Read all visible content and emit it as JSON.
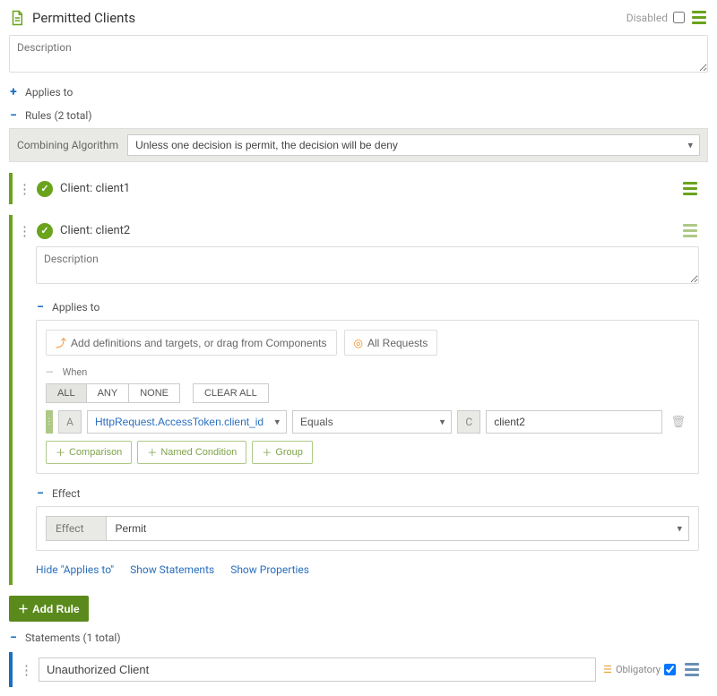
{
  "header": {
    "title": "Permitted Clients",
    "disabled_label": "Disabled"
  },
  "description": {
    "placeholder": "Description"
  },
  "sections": {
    "applies_to": "Applies to",
    "rules_label": "Rules (2 total)",
    "statements_label": "Statements (1 total)"
  },
  "combining": {
    "label": "Combining Algorithm",
    "value": "Unless one decision is permit, the decision will be deny"
  },
  "rule1": {
    "title": "Client: client1"
  },
  "rule2": {
    "title": "Client: client2",
    "desc_placeholder": "Description",
    "applies_to_label": "Applies to",
    "add_targets_btn": "Add definitions and targets, or drag from Components",
    "all_requests_btn": "All Requests",
    "when_label": "When",
    "mode_all": "ALL",
    "mode_any": "ANY",
    "mode_none": "NONE",
    "clear_all": "CLEAR ALL",
    "A": "A",
    "attr": "HttpRequest.AccessToken.client_id",
    "op": "Equals",
    "C": "C",
    "value": "client2",
    "add_comparison": "Comparison",
    "add_named": "Named Condition",
    "add_group": "Group",
    "effect_label": "Effect",
    "effect_col": "Effect",
    "effect_value": "Permit",
    "hide_applies": "Hide \"Applies to\"",
    "show_statements": "Show Statements",
    "show_properties": "Show Properties"
  },
  "add_rule_btn": "Add Rule",
  "statement": {
    "value": "Unauthorized Client",
    "obligatory_label": "Obligatory"
  }
}
